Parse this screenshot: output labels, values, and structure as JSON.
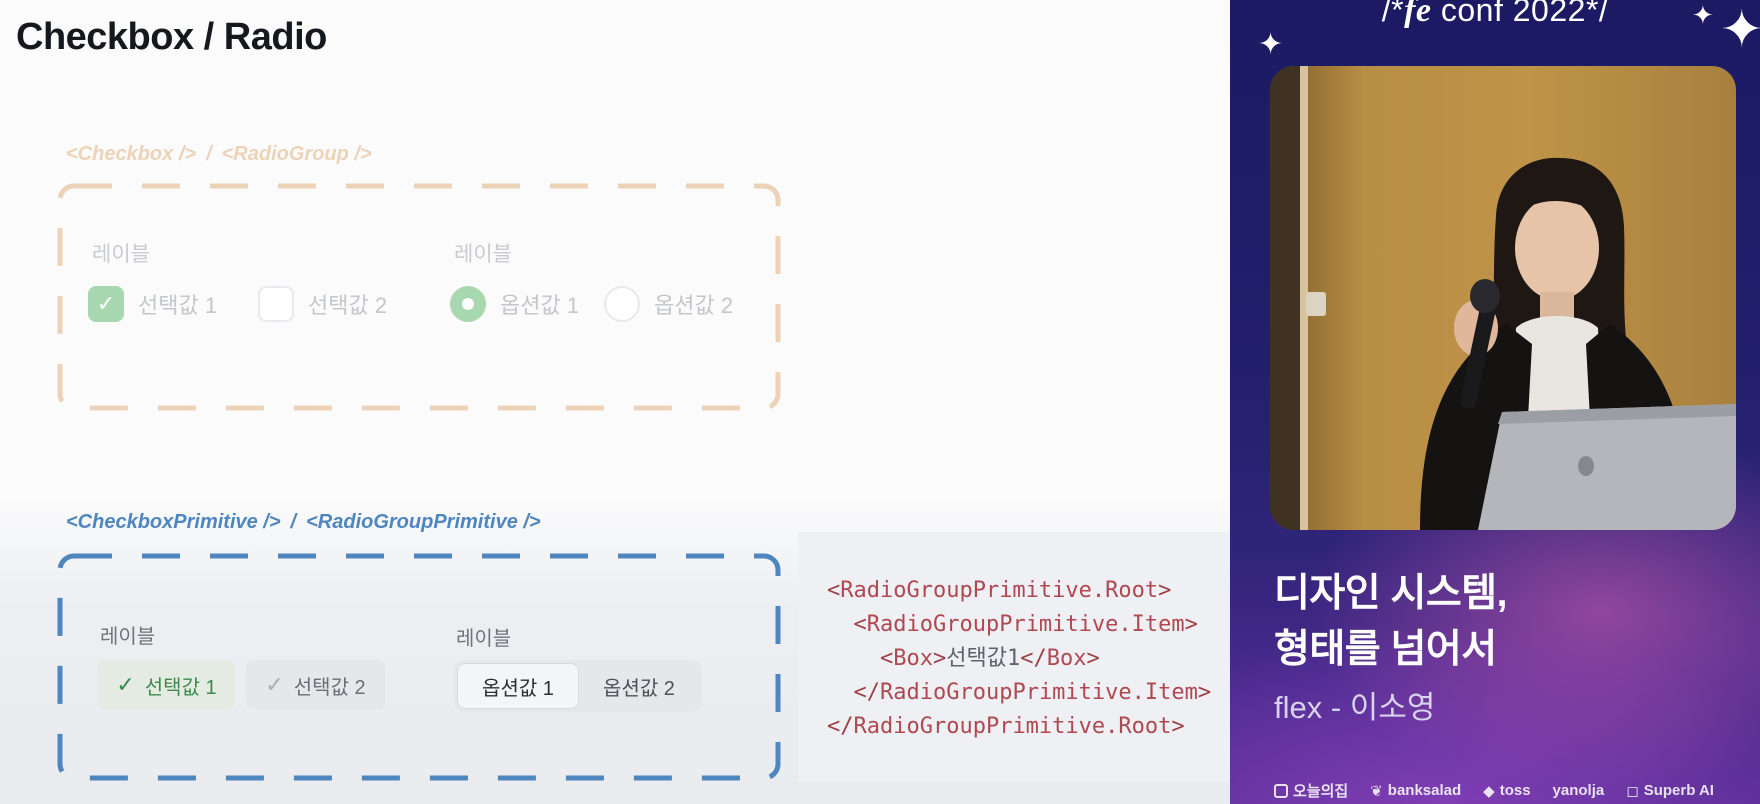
{
  "slide": {
    "title": "Checkbox / Radio",
    "top_section": {
      "component_checkbox": "<Checkbox />",
      "separator": "/",
      "component_radio": "<RadioGroup />",
      "checkbox_group_label": "레이블",
      "radio_group_label": "레이블",
      "checkbox_options": [
        {
          "label": "선택값 1",
          "checked": true
        },
        {
          "label": "선택값 2",
          "checked": false
        }
      ],
      "radio_options": [
        {
          "label": "옵션값 1",
          "selected": true
        },
        {
          "label": "옵션값 2",
          "selected": false
        }
      ],
      "accent_color": "#a8d8b0",
      "border_color": "#ecd3b8"
    },
    "bottom_section": {
      "component_checkbox": "<CheckboxPrimitive />",
      "separator": "/",
      "component_radio": "<RadioGroupPrimitive />",
      "checkbox_group_label": "레이블",
      "radio_group_label": "레이블",
      "checkbox_options": [
        {
          "label": "선택값 1",
          "checked": true
        },
        {
          "label": "선택값 2",
          "checked": false
        }
      ],
      "radio_options": [
        {
          "label": "옵션값 1",
          "selected": true
        },
        {
          "label": "옵션값 2",
          "selected": false
        }
      ],
      "border_color": "#4e86bf"
    },
    "code": {
      "line1_open": "<",
      "line1_tag": "RadioGroupPrimitive.Root",
      "line1_close": ">",
      "line2_open": "<",
      "line2_tag": "RadioGroupPrimitive.Item",
      "line2_close": ">",
      "line3_open": "<",
      "line3_tag": "Box",
      "line3_close": ">",
      "line3_text": "선택값1",
      "line3_end_open": "</",
      "line3_end_tag": "Box",
      "line3_end_close": ">",
      "line4_open": "</",
      "line4_tag": "RadioGroupPrimitive.Item",
      "line4_close": ">",
      "line5_open": "</",
      "line5_tag": "RadioGroupPrimitive.Root",
      "line5_close": ">"
    }
  },
  "conference": {
    "title_prefix": "/*",
    "title_mark": "fe",
    "title_main": "conf 2022",
    "title_suffix": "*/",
    "talk_title_line1": "디자인 시스템,",
    "talk_title_line2": "형태를 넘어서",
    "speaker": "flex - 이소영",
    "sponsors": [
      {
        "name": "오늘의집",
        "icon": "house-icon"
      },
      {
        "name": "banksalad",
        "icon": "banksalad-icon"
      },
      {
        "name": "toss",
        "icon": "toss-icon"
      },
      {
        "name": "yanolja",
        "icon": ""
      },
      {
        "name": "Superb AI",
        "icon": "superb-icon"
      }
    ]
  }
}
